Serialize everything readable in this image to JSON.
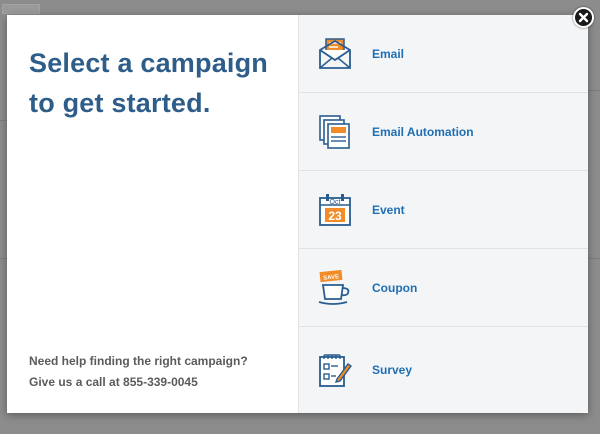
{
  "modal": {
    "headline": "Select a campaign to get started.",
    "help_line1": "Need help finding the right campaign?",
    "help_line2": "Give us a call at 855-339-0045",
    "options": [
      {
        "label": "Email",
        "icon": "email-envelope-icon"
      },
      {
        "label": "Email Automation",
        "icon": "email-automation-icon"
      },
      {
        "label": "Event",
        "icon": "calendar-event-icon"
      },
      {
        "label": "Coupon",
        "icon": "coupon-cup-icon"
      },
      {
        "label": "Survey",
        "icon": "survey-clipboard-icon"
      }
    ],
    "calendar_month": "Oct",
    "calendar_day": "23",
    "coupon_tag": "SAVE",
    "close_icon": "close-icon"
  },
  "colors": {
    "headline": "#2e5d8a",
    "option_label": "#1f6fb2",
    "icon_blue": "#2a5d8f",
    "icon_orange": "#f28c28"
  }
}
